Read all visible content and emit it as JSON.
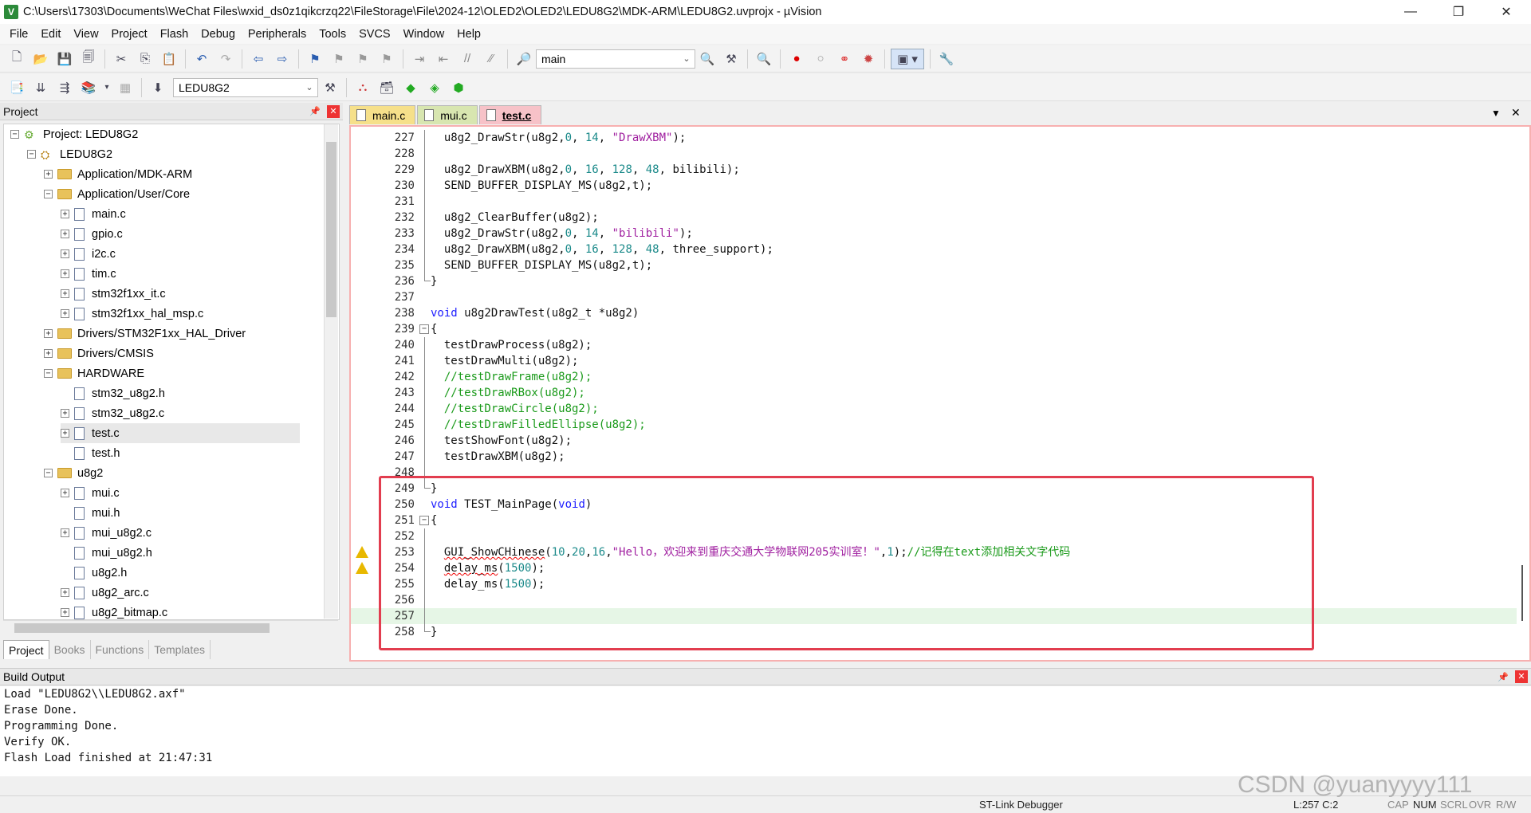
{
  "window": {
    "title": "C:\\Users\\17303\\Documents\\WeChat Files\\wxid_ds0z1qikcrzq22\\FileStorage\\File\\2024-12\\OLED2\\OLED2\\LEDU8G2\\MDK-ARM\\LEDU8G2.uvprojx - µVision",
    "minimize_glyph": "—",
    "restore_glyph": "❐",
    "close_glyph": "✕",
    "app_icon_glyph": "V"
  },
  "menu": [
    "File",
    "Edit",
    "View",
    "Project",
    "Flash",
    "Debug",
    "Peripherals",
    "Tools",
    "SVCS",
    "Window",
    "Help"
  ],
  "toolbar1": {
    "combo_value": "main"
  },
  "toolbar2": {
    "target_value": "LEDU8G2"
  },
  "project_panel": {
    "title": "Project",
    "pin_glyph": "📌",
    "close_glyph": "✕",
    "tree": [
      {
        "label": "Project: LEDU8G2",
        "indent": 0,
        "icon": "project",
        "exp": "−"
      },
      {
        "label": "LEDU8G2",
        "indent": 1,
        "icon": "target",
        "exp": "−"
      },
      {
        "label": "Application/MDK-ARM",
        "indent": 2,
        "icon": "folder",
        "exp": "+"
      },
      {
        "label": "Application/User/Core",
        "indent": 2,
        "icon": "folder",
        "exp": "−"
      },
      {
        "label": "main.c",
        "indent": 3,
        "icon": "file",
        "exp": "+"
      },
      {
        "label": "gpio.c",
        "indent": 3,
        "icon": "file",
        "exp": "+"
      },
      {
        "label": "i2c.c",
        "indent": 3,
        "icon": "file",
        "exp": "+"
      },
      {
        "label": "tim.c",
        "indent": 3,
        "icon": "file",
        "exp": "+"
      },
      {
        "label": "stm32f1xx_it.c",
        "indent": 3,
        "icon": "file",
        "exp": "+"
      },
      {
        "label": "stm32f1xx_hal_msp.c",
        "indent": 3,
        "icon": "file",
        "exp": "+"
      },
      {
        "label": "Drivers/STM32F1xx_HAL_Driver",
        "indent": 2,
        "icon": "folder",
        "exp": "+"
      },
      {
        "label": "Drivers/CMSIS",
        "indent": 2,
        "icon": "folder",
        "exp": "+"
      },
      {
        "label": "HARDWARE",
        "indent": 2,
        "icon": "folder",
        "exp": "−"
      },
      {
        "label": "stm32_u8g2.h",
        "indent": 3,
        "icon": "file",
        "exp": ""
      },
      {
        "label": "stm32_u8g2.c",
        "indent": 3,
        "icon": "file",
        "exp": "+"
      },
      {
        "label": "test.c",
        "indent": 3,
        "icon": "file",
        "exp": "+",
        "selected": true
      },
      {
        "label": "test.h",
        "indent": 3,
        "icon": "file",
        "exp": ""
      },
      {
        "label": "u8g2",
        "indent": 2,
        "icon": "folder",
        "exp": "−"
      },
      {
        "label": "mui.c",
        "indent": 3,
        "icon": "file",
        "exp": "+"
      },
      {
        "label": "mui.h",
        "indent": 3,
        "icon": "file",
        "exp": ""
      },
      {
        "label": "mui_u8g2.c",
        "indent": 3,
        "icon": "file",
        "exp": "+"
      },
      {
        "label": "mui_u8g2.h",
        "indent": 3,
        "icon": "file",
        "exp": ""
      },
      {
        "label": "u8g2.h",
        "indent": 3,
        "icon": "file",
        "exp": ""
      },
      {
        "label": "u8g2_arc.c",
        "indent": 3,
        "icon": "file",
        "exp": "+"
      },
      {
        "label": "u8g2_bitmap.c",
        "indent": 3,
        "icon": "file",
        "exp": "+"
      }
    ],
    "bottom_tabs": [
      {
        "label": "Project",
        "active": true
      },
      {
        "label": "Books",
        "active": false
      },
      {
        "label": "Functions",
        "active": false
      },
      {
        "label": "Templates",
        "active": false
      }
    ]
  },
  "editor_tabs": [
    {
      "label": "main.c",
      "bg": "#f6e08a"
    },
    {
      "label": "mui.c",
      "bg": "#d8e6b0"
    },
    {
      "label": "test.c",
      "bg": "#f7c2c8",
      "active": true
    }
  ],
  "editor_tab_menu_glyph": "▼",
  "editor_close_glyph": "✕",
  "code": [
    {
      "n": "227",
      "t": "  u8g2_DrawStr(u8g2,0, 14, \"DrawXBM\");",
      "g": "bar"
    },
    {
      "n": "228",
      "t": "",
      "g": "bar"
    },
    {
      "n": "229",
      "t": "  u8g2_DrawXBM(u8g2,0, 16, 128, 48, bilibili);",
      "g": "bar"
    },
    {
      "n": "230",
      "t": "  SEND_BUFFER_DISPLAY_MS(u8g2,t);",
      "g": "bar"
    },
    {
      "n": "231",
      "t": "",
      "g": "bar"
    },
    {
      "n": "232",
      "t": "  u8g2_ClearBuffer(u8g2);",
      "g": "bar"
    },
    {
      "n": "233",
      "t": "  u8g2_DrawStr(u8g2,0, 14, \"bilibili\");",
      "g": "bar"
    },
    {
      "n": "234",
      "t": "  u8g2_DrawXBM(u8g2,0, 16, 128, 48, three_support);",
      "g": "bar"
    },
    {
      "n": "235",
      "t": "  SEND_BUFFER_DISPLAY_MS(u8g2,t);",
      "g": "bar"
    },
    {
      "n": "236",
      "t": "}",
      "g": "corner"
    },
    {
      "n": "237",
      "t": "",
      "g": ""
    },
    {
      "n": "238",
      "t": "void u8g2DrawTest(u8g2_t *u8g2)",
      "g": ""
    },
    {
      "n": "239",
      "t": "{",
      "g": "fold"
    },
    {
      "n": "240",
      "t": "  testDrawProcess(u8g2);",
      "g": "bar"
    },
    {
      "n": "241",
      "t": "  testDrawMulti(u8g2);",
      "g": "bar"
    },
    {
      "n": "242",
      "t": "  //testDrawFrame(u8g2);",
      "g": "bar"
    },
    {
      "n": "243",
      "t": "  //testDrawRBox(u8g2);",
      "g": "bar"
    },
    {
      "n": "244",
      "t": "  //testDrawCircle(u8g2);",
      "g": "bar"
    },
    {
      "n": "245",
      "t": "  //testDrawFilledEllipse(u8g2);",
      "g": "bar"
    },
    {
      "n": "246",
      "t": "  testShowFont(u8g2);",
      "g": "bar"
    },
    {
      "n": "247",
      "t": "  testDrawXBM(u8g2);",
      "g": "bar"
    },
    {
      "n": "248",
      "t": "",
      "g": "bar"
    },
    {
      "n": "249",
      "t": "}",
      "g": "corner"
    },
    {
      "n": "250",
      "t": "void TEST_MainPage(void)",
      "g": ""
    },
    {
      "n": "251",
      "t": "{",
      "g": "fold"
    },
    {
      "n": "252",
      "t": "",
      "g": "bar"
    },
    {
      "n": "253",
      "t": "  GUI_ShowCHinese(10,20,16,\"Hello，欢迎来到重庆交通大学物联网205实训室！\",1);//记得在text添加相关文字代码",
      "g": "bar",
      "warn": true
    },
    {
      "n": "254",
      "t": "  delay_ms(1500);",
      "g": "bar",
      "warn": true
    },
    {
      "n": "255",
      "t": "  delay_ms(1500);",
      "g": "bar"
    },
    {
      "n": "256",
      "t": "",
      "g": "bar"
    },
    {
      "n": "257",
      "t": "",
      "g": "bar",
      "hl": true
    },
    {
      "n": "258",
      "t": "}",
      "g": "corner"
    }
  ],
  "build_output": {
    "title": "Build Output",
    "lines": [
      "Load \"LEDU8G2\\\\LEDU8G2.axf\"",
      "Erase Done.",
      "Programming Done.",
      "Verify OK.",
      "Flash Load finished at 21:47:31"
    ]
  },
  "status": {
    "debugger": "ST-Link Debugger",
    "position": "L:257 C:2",
    "cap": "CAP",
    "num": "NUM",
    "scrl": "SCRL",
    "ovr": "OVR",
    "rw": "R/W"
  },
  "watermark": "CSDN @yuanyyyy111"
}
